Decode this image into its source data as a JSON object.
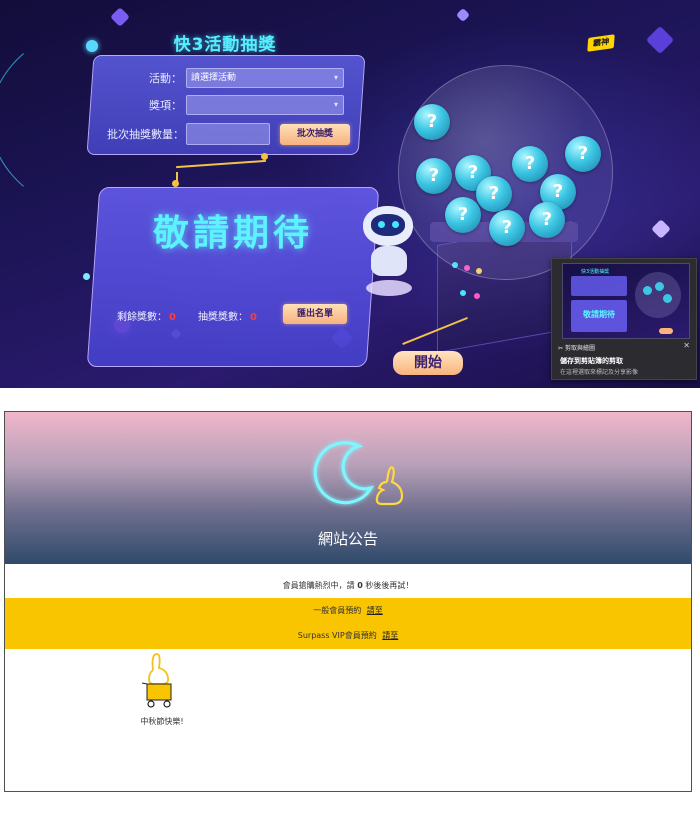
{
  "lottery": {
    "title": "快3活動抽獎",
    "brand_tag": "霸神",
    "form": {
      "activity_label": "活動：",
      "activity_value": "請選擇活動",
      "prize_label": "獎項：",
      "prize_value": "",
      "batch_label": "批次抽獎數量：",
      "batch_value": "",
      "batch_button": "批次抽獎"
    },
    "result": {
      "display_text": "敬請期待",
      "remaining_label": "剩餘獎數：",
      "remaining_value": "0",
      "drawn_label": "抽獎獎數：",
      "drawn_value": "0",
      "export_button": "匯出名單"
    },
    "machine": {
      "ball_symbol": "?"
    },
    "start_button": "開始",
    "toast": {
      "thumb_title": "快3活動抽獎",
      "thumb_text": "敬請期待",
      "app_name": "剪取與繪圖",
      "close": "✕",
      "title": "儲存到剪貼簿的剪取",
      "message": "在這裡選取來標記及分享影像"
    }
  },
  "notice": {
    "title": "網站公告",
    "busy_prefix": "會員搶購熱烈中，請",
    "busy_seconds": "0",
    "busy_suffix": "秒後後再試！",
    "general_label": "一般會員預約",
    "general_link": "請至",
    "vip_label": "Surpass VIP會員預約",
    "vip_link": "請至",
    "festival_text": "中秋節快樂!"
  },
  "colors": {
    "accent_cyan": "#54f0ff",
    "notice_band": "#f8c500",
    "stat_red": "#ff3b3b",
    "button_peach": "#f7b27e"
  }
}
